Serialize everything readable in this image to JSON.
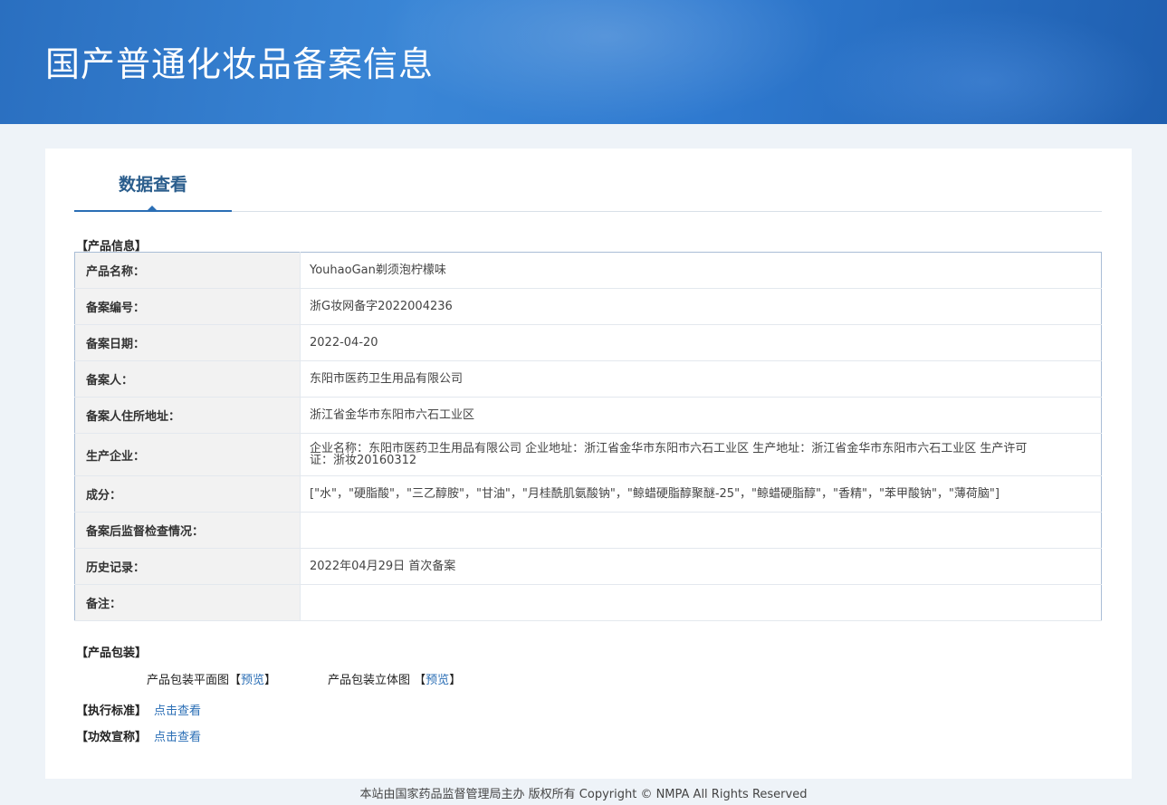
{
  "header": {
    "title": "国产普通化妆品备案信息"
  },
  "tabs": [
    {
      "label": "数据查看"
    }
  ],
  "product_info": {
    "section_title": "【产品信息】",
    "rows": [
      {
        "label": "产品名称：",
        "value": "YouhaoGan剃须泡柠檬味"
      },
      {
        "label": "备案编号：",
        "value": "浙G妆网备字2022004236"
      },
      {
        "label": "备案日期：",
        "value": "2022-04-20"
      },
      {
        "label": "备案人：",
        "value": "东阳市医药卫生用品有限公司"
      },
      {
        "label": "备案人住所地址：",
        "value": "浙江省金华市东阳市六石工业区"
      },
      {
        "label": "生产企业：",
        "value": "企业名称：东阳市医药卫生用品有限公司 企业地址：浙江省金华市东阳市六石工业区 生产地址：浙江省金华市东阳市六石工业区 生产许可证：浙妆20160312"
      },
      {
        "label": "成分：",
        "value": "[\"水\"，\"硬脂酸\"，\"三乙醇胺\"，\"甘油\"，\"月桂酰肌氨酸钠\"，\"鲸蜡硬脂醇聚醚-25\"，\"鲸蜡硬脂醇\"，\"香精\"，\"苯甲酸钠\"，\"薄荷脑\"]"
      },
      {
        "label": "备案后监督检查情况：",
        "value": ""
      },
      {
        "label": "历史记录：",
        "value": "2022年04月29日 首次备案"
      },
      {
        "label": "备注：",
        "value": ""
      }
    ]
  },
  "packaging": {
    "section_title": "【产品包装】",
    "flat_label": "产品包装平面图",
    "flat_link": "预览",
    "solid_label": "产品包装立体图",
    "solid_link": "预览",
    "bracket_open": "【",
    "bracket_close": "】"
  },
  "standard": {
    "label": "【执行标准】",
    "link": "点击查看"
  },
  "efficacy": {
    "label": "【功效宣称】",
    "link": "点击查看"
  },
  "footer": {
    "text": "本站由国家药品监督管理局主办 版权所有 Copyright © NMPA All Rights Reserved"
  }
}
